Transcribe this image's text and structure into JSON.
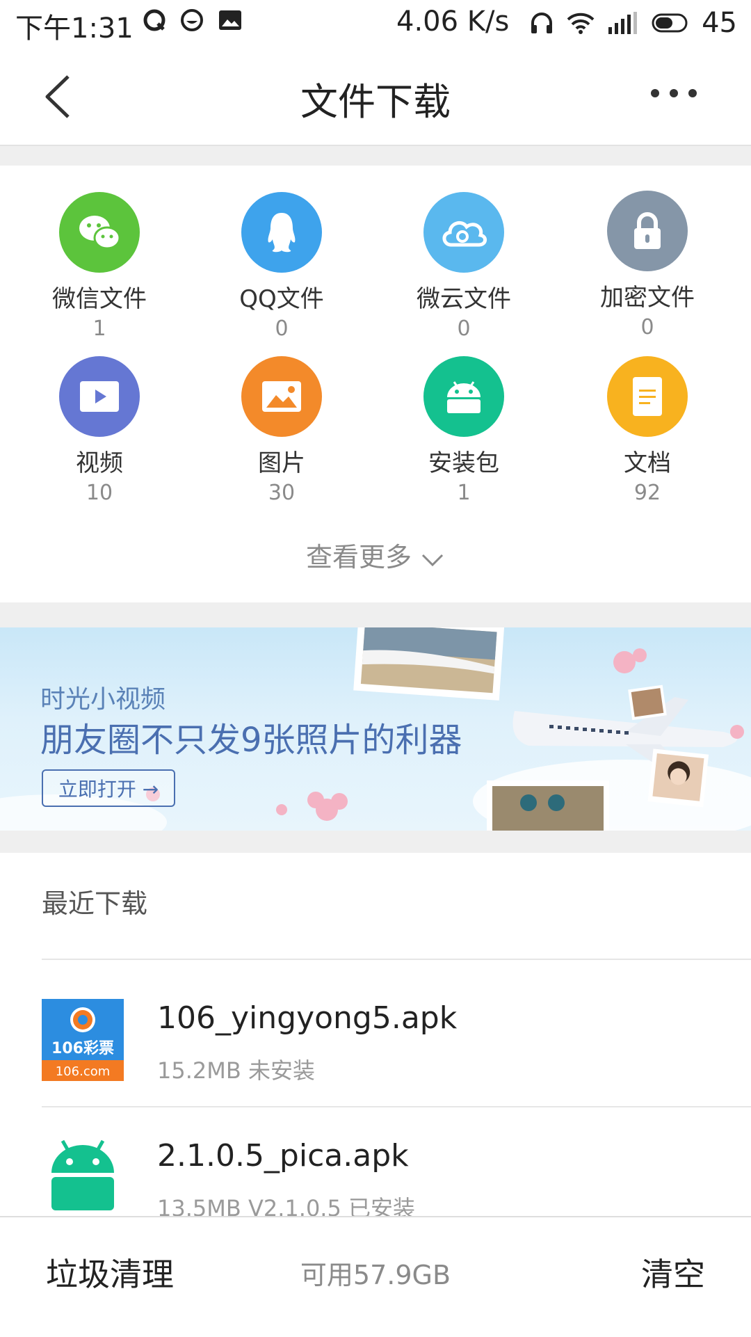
{
  "status_bar": {
    "time": "下午1:31",
    "speed": "4.06 K/s",
    "battery": "45"
  },
  "header": {
    "title": "文件下载"
  },
  "categories": [
    {
      "label": "微信文件",
      "count": "1",
      "icon": "wechat-icon",
      "color": "#5cc43c"
    },
    {
      "label": "QQ文件",
      "count": "0",
      "icon": "qq-icon",
      "color": "#3ea3ec"
    },
    {
      "label": "微云文件",
      "count": "0",
      "icon": "weiyun-icon",
      "color": "#5ab8ee"
    },
    {
      "label": "加密文件",
      "count": "0",
      "icon": "lock-icon",
      "color": "#8596a8"
    },
    {
      "label": "视频",
      "count": "10",
      "icon": "video-icon",
      "color": "#6577d3"
    },
    {
      "label": "图片",
      "count": "30",
      "icon": "image-icon",
      "color": "#f38a2a"
    },
    {
      "label": "安装包",
      "count": "1",
      "icon": "android-icon",
      "color": "#14c18f"
    },
    {
      "label": "文档",
      "count": "92",
      "icon": "document-icon",
      "color": "#f8b21f"
    }
  ],
  "see_more": "查看更多",
  "banner": {
    "subtitle": "时光小视频",
    "title": "朋友圈不只发9张照片的利器",
    "button": "立即打开 →"
  },
  "recent": {
    "heading": "最近下载",
    "files": [
      {
        "name": "106_yingyong5.apk",
        "meta": "15.2MB  未安装",
        "icon_text_top": "106彩票",
        "icon_text_bottom": "106.com"
      },
      {
        "name": "2.1.0.5_pica.apk",
        "meta": "13.5MB  V2.1.0.5 已安装"
      }
    ]
  },
  "bottom_bar": {
    "left": "垃圾清理",
    "middle": "可用57.9GB",
    "right": "清空"
  }
}
